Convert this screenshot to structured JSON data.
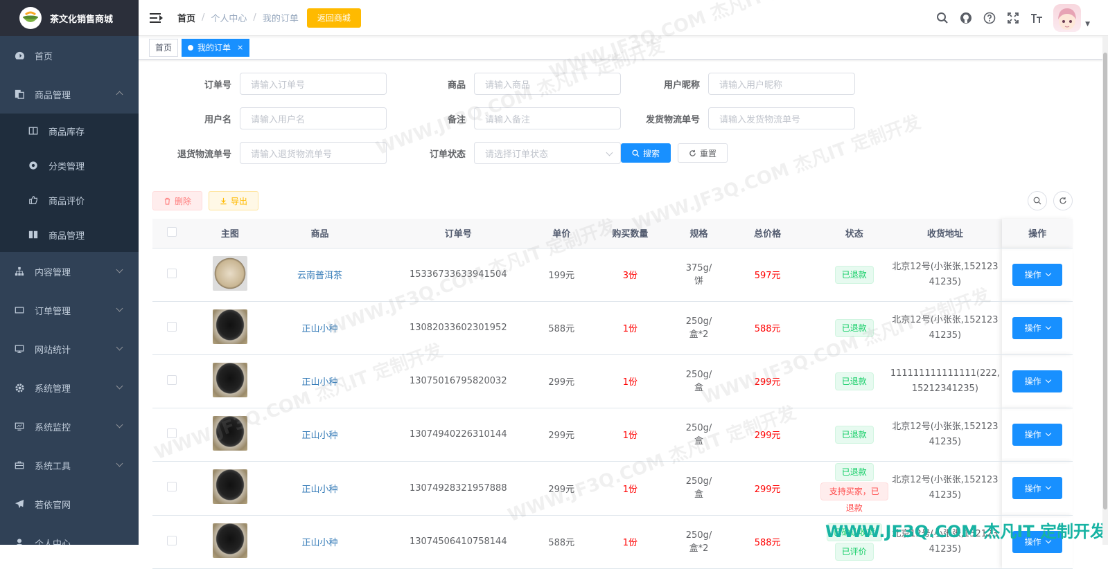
{
  "app": {
    "title": "茶文化销售商城"
  },
  "sidebar": {
    "items": [
      {
        "label": "首页",
        "icon": "dashboard-icon"
      },
      {
        "label": "商品管理",
        "icon": "goods-icon",
        "expanded": true
      },
      {
        "label": "商品库存",
        "icon": "stock-icon"
      },
      {
        "label": "分类管理",
        "icon": "category-icon"
      },
      {
        "label": "商品评价",
        "icon": "review-icon"
      },
      {
        "label": "商品管理",
        "icon": "goods-manage-icon"
      },
      {
        "label": "内容管理",
        "icon": "tree-icon"
      },
      {
        "label": "订单管理",
        "icon": "order-icon"
      },
      {
        "label": "网站统计",
        "icon": "monitor-icon"
      },
      {
        "label": "系统管理",
        "icon": "gear-icon"
      },
      {
        "label": "系统监控",
        "icon": "monitor-chart-icon"
      },
      {
        "label": "系统工具",
        "icon": "toolbox-icon"
      },
      {
        "label": "若依官网",
        "icon": "send-icon"
      },
      {
        "label": "个人中心",
        "icon": "user-icon"
      }
    ]
  },
  "navbar": {
    "breadcrumb": [
      "首页",
      "个人中心",
      "我的订单"
    ],
    "back_button": "返回商城"
  },
  "tags": {
    "home": "首页",
    "active": "我的订单",
    "close": "×"
  },
  "form": {
    "order_no": {
      "label": "订单号",
      "placeholder": "请输入订单号"
    },
    "goods": {
      "label": "商品",
      "placeholder": "请输入商品"
    },
    "nickname": {
      "label": "用户昵称",
      "placeholder": "请输入用户昵称"
    },
    "username": {
      "label": "用户名",
      "placeholder": "请输入用户名"
    },
    "remark": {
      "label": "备注",
      "placeholder": "请输入备注"
    },
    "ship_no": {
      "label": "发货物流单号",
      "placeholder": "请输入发货物流单号"
    },
    "return_no": {
      "label": "退货物流单号",
      "placeholder": "请输入退货物流单号"
    },
    "status": {
      "label": "订单状态",
      "placeholder": "请选择订单状态"
    },
    "search_button": "搜索",
    "reset_button": "重置"
  },
  "toolbar": {
    "delete_label": "删除",
    "export_label": "导出"
  },
  "table": {
    "headers": [
      "主图",
      "商品",
      "订单号",
      "单价",
      "购买数量",
      "规格",
      "总价格",
      "状态",
      "收货地址",
      "操作"
    ],
    "op_label": "操作",
    "rows": [
      {
        "image": "puer",
        "goods": "云南普洱茶",
        "order_no": "15336733633941504",
        "price": "199元",
        "qty": "3份",
        "spec": "375g/饼",
        "total": "597元",
        "status": [
          "已退款"
        ],
        "address": "北京12号(小张张,15212341235)"
      },
      {
        "image": "black",
        "goods": "正山小种",
        "order_no": "13082033602301952",
        "price": "588元",
        "qty": "1份",
        "spec": "250g/盒*2",
        "total": "588元",
        "status": [
          "已退款"
        ],
        "address": "北京12号(小张张,15212341235)"
      },
      {
        "image": "black",
        "goods": "正山小种",
        "order_no": "13075016795820032",
        "price": "299元",
        "qty": "1份",
        "spec": "250g/盒",
        "total": "299元",
        "status": [
          "已退款"
        ],
        "address": "111111111111111(222,15212341235)"
      },
      {
        "image": "black",
        "goods": "正山小种",
        "order_no": "13074940226310144",
        "price": "299元",
        "qty": "1份",
        "spec": "250g/盒",
        "total": "299元",
        "status": [
          "已退款"
        ],
        "address": "北京12号(小张张,15212341235)"
      },
      {
        "image": "black",
        "goods": "正山小种",
        "order_no": "13074928321957888",
        "price": "299元",
        "qty": "1份",
        "spec": "250g/盒",
        "total": "299元",
        "status": [
          "已退款",
          "支持买家，已退款"
        ],
        "address": "北京12号(小张张,15212341235)"
      },
      {
        "image": "black",
        "goods": "正山小种",
        "order_no": "13074506410758144",
        "price": "588元",
        "qty": "1份",
        "spec": "250g/盒*2",
        "total": "588元",
        "status": [
          "已确认收货",
          "已评价"
        ],
        "address": "北京12号(小张张,15212341235)"
      }
    ]
  },
  "watermark": {
    "text": "WWW.JF3Q.COM 杰凡IT 定制开发"
  }
}
